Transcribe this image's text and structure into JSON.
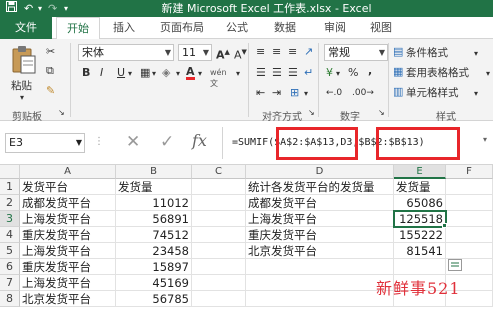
{
  "window": {
    "title": "新建 Microsoft Excel 工作表.xlsx - Excel",
    "quick_access": [
      "save-icon",
      "undo-icon",
      "redo-icon"
    ]
  },
  "ribbon_tabs": [
    {
      "label": "文件"
    },
    {
      "label": "开始"
    },
    {
      "label": "插入"
    },
    {
      "label": "页面布局"
    },
    {
      "label": "公式"
    },
    {
      "label": "数据"
    },
    {
      "label": "审阅"
    },
    {
      "label": "视图"
    }
  ],
  "ribbon": {
    "clipboard": {
      "paste_label": "粘贴",
      "group_label": "剪贴板"
    },
    "font": {
      "font_name": "宋体",
      "font_size": "11",
      "bold": "B",
      "italic": "I",
      "underline": "U",
      "font_color_glyph": "A",
      "wen": "wén"
    },
    "alignment": {
      "group_label": "对齐方式"
    },
    "number": {
      "format": "常规",
      "percent": "%",
      "comma": ",",
      "group_label": "数字"
    },
    "styles": {
      "conditional": "条件格式",
      "table": "套用表格格式",
      "cell": "单元格样式",
      "group_label": "样式"
    }
  },
  "formula_bar": {
    "name_box": "E3",
    "fx_label": "fx",
    "formula": "=SUMIF($A$2:$A$13,D3,$B$2:$B$13)"
  },
  "columns": [
    "A",
    "B",
    "C",
    "D",
    "E",
    "F"
  ],
  "rows": [
    {
      "n": "1",
      "A": "发货平台",
      "B": "发货量",
      "D": "统计各发货平台的发货量",
      "E": "发货量"
    },
    {
      "n": "2",
      "A": "成都发货平台",
      "B": "11012",
      "D": "成都发货平台",
      "E": "65086"
    },
    {
      "n": "3",
      "A": "上海发货平台",
      "B": "56891",
      "D": "上海发货平台",
      "E": "125518"
    },
    {
      "n": "4",
      "A": "重庆发货平台",
      "B": "74512",
      "D": "重庆发货平台",
      "E": "155222"
    },
    {
      "n": "5",
      "A": "上海发货平台",
      "B": "23458",
      "D": "北京发货平台",
      "E": "81541"
    },
    {
      "n": "6",
      "A": "重庆发货平台",
      "B": "15897",
      "D": "",
      "E": ""
    },
    {
      "n": "7",
      "A": "上海发货平台",
      "B": "45169",
      "D": "",
      "E": ""
    },
    {
      "n": "8",
      "A": "北京发货平台",
      "B": "56785",
      "D": "",
      "E": ""
    }
  ],
  "watermark": "新鲜事521",
  "colors": {
    "excel_green": "#217346",
    "highlight_red": "#e8262a"
  }
}
